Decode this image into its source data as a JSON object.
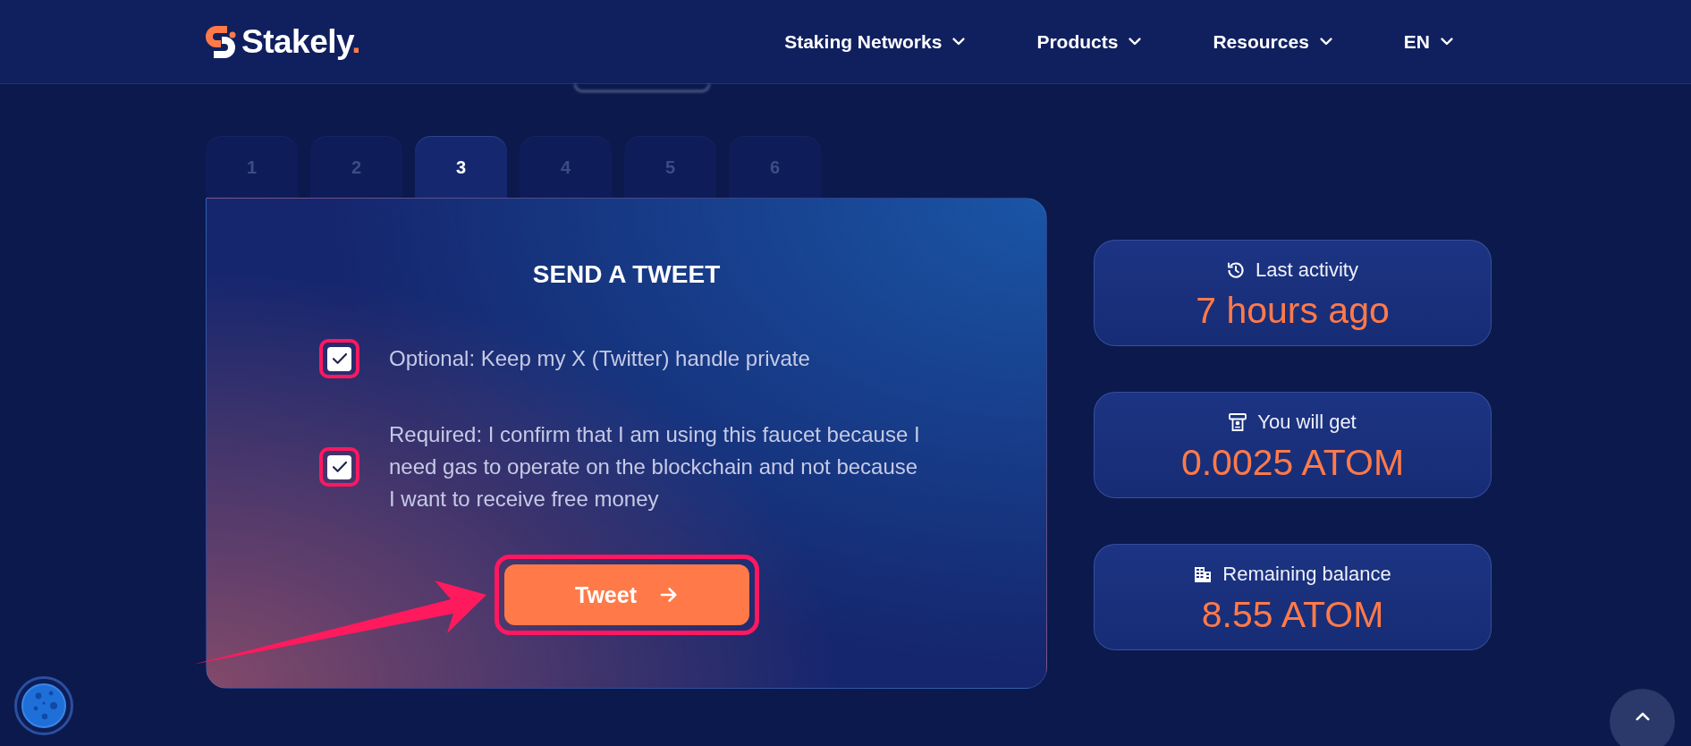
{
  "header": {
    "logo": {
      "name": "Stakely",
      "mark": "."
    },
    "nav": [
      {
        "label": "Staking Networks"
      },
      {
        "label": "Products"
      },
      {
        "label": "Resources"
      },
      {
        "label": "EN"
      }
    ]
  },
  "step_tabs": [
    {
      "label": "1",
      "selected": false
    },
    {
      "label": "2",
      "selected": false
    },
    {
      "label": "3",
      "selected": true
    },
    {
      "label": "4",
      "selected": false
    },
    {
      "label": "5",
      "selected": false
    },
    {
      "label": "6",
      "selected": false
    }
  ],
  "task": {
    "title": "SEND A TWEET",
    "checkboxes": [
      {
        "label": "Optional: Keep my X (Twitter) handle private",
        "checked": true,
        "highlighted": true
      },
      {
        "label": "Required: I confirm that I am using this faucet because I need gas to operate on the blockchain and not because I want to receive free money",
        "checked": true,
        "highlighted": true
      }
    ],
    "button": {
      "label": "Tweet",
      "highlighted": true
    }
  },
  "stats": [
    {
      "label": "Last activity",
      "value": "7 hours ago"
    },
    {
      "label": "You will get",
      "value": "0.0025 ATOM"
    },
    {
      "label": "Remaining balance",
      "value": "8.55 ATOM"
    }
  ]
}
